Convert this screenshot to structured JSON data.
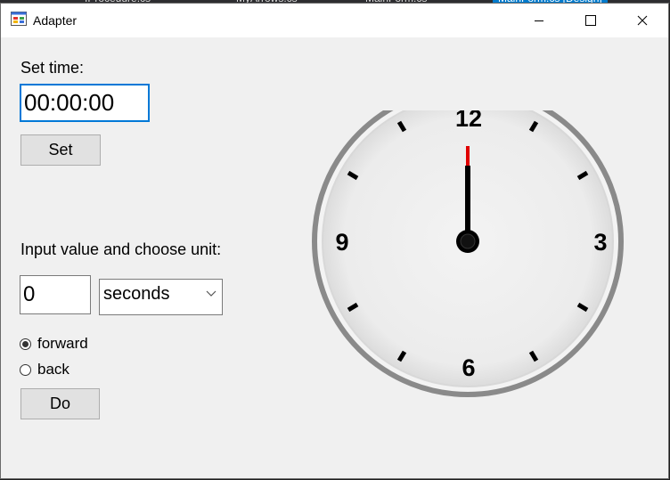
{
  "window": {
    "title": "Adapter",
    "icon": "app-icon"
  },
  "set_time": {
    "label": "Set time:",
    "value": "00:00:00",
    "button_label": "Set"
  },
  "unit_section": {
    "label": "Input value and choose unit:",
    "value": "0",
    "unit_selected": "seconds",
    "radios": [
      {
        "label": "forward",
        "checked": true
      },
      {
        "label": "back",
        "checked": false
      }
    ],
    "button_label": "Do"
  },
  "clock": {
    "numerals": {
      "n12": "12",
      "n3": "3",
      "n6": "6",
      "n9": "9"
    },
    "time": {
      "hours": 0,
      "minutes": 0,
      "seconds": 0
    }
  },
  "colors": {
    "second_hand": "#e00000",
    "focus_border": "#0078d7"
  }
}
